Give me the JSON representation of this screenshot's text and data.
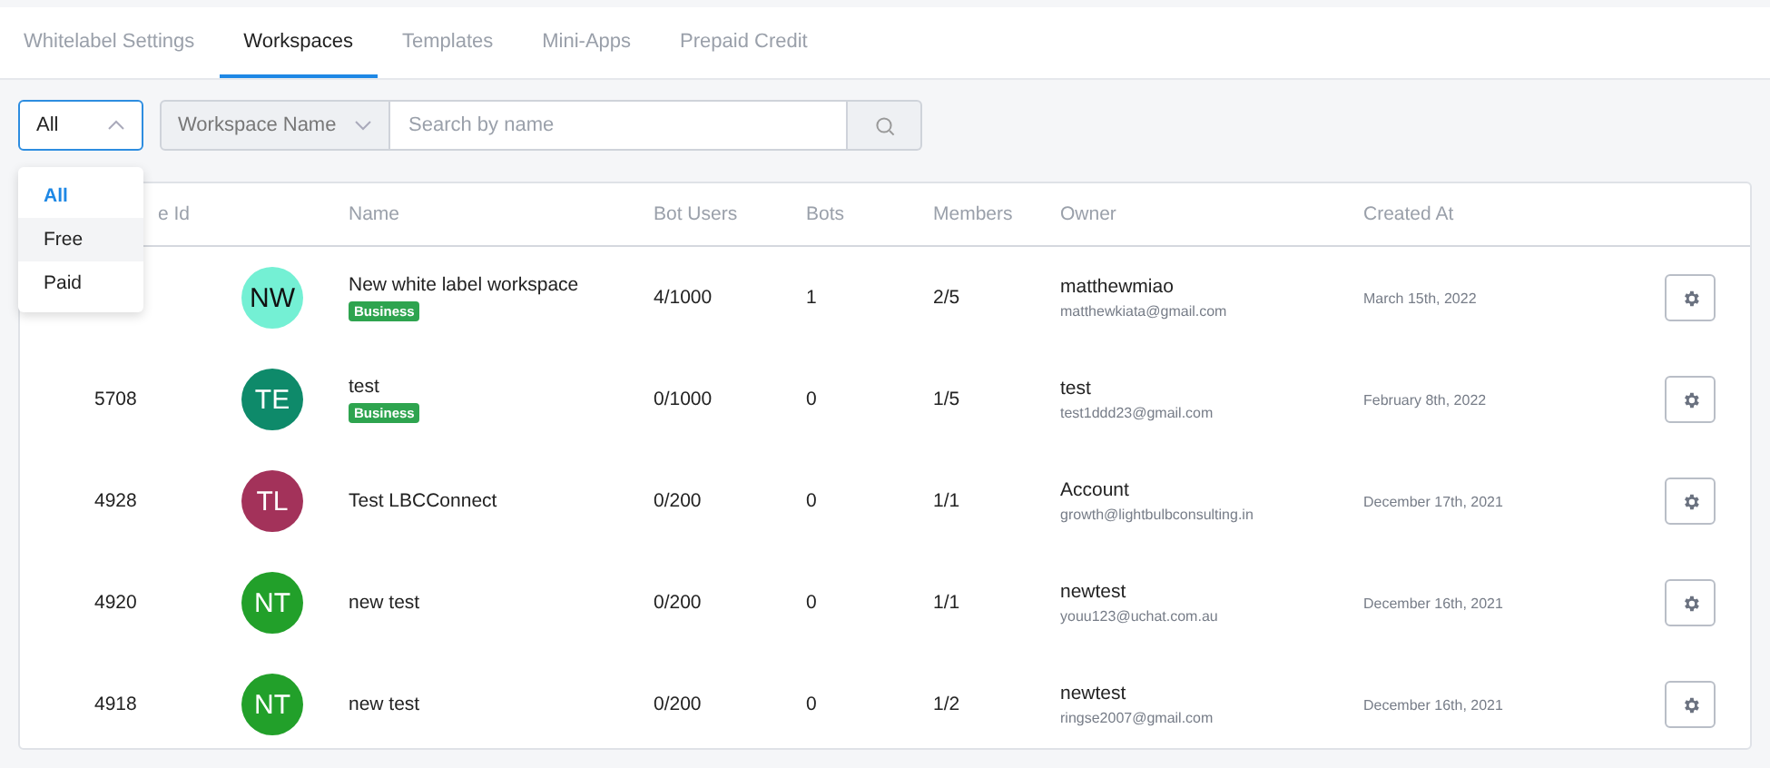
{
  "tabs": [
    {
      "label": "Whitelabel Settings",
      "selected": false
    },
    {
      "label": "Workspaces",
      "selected": true
    },
    {
      "label": "Templates",
      "selected": false
    },
    {
      "label": "Mini-Apps",
      "selected": false
    },
    {
      "label": "Prepaid Credit",
      "selected": false
    }
  ],
  "filters": {
    "plan_select": {
      "value": "All",
      "expanded": true
    },
    "field_select": {
      "value": "Workspace Name",
      "expanded": false
    },
    "search": {
      "placeholder": "Search by name"
    }
  },
  "plan_menu": [
    {
      "label": "All",
      "selected": true,
      "highlighted": false
    },
    {
      "label": "Free",
      "selected": false,
      "highlighted": true
    },
    {
      "label": "Paid",
      "selected": false,
      "highlighted": false
    }
  ],
  "table": {
    "columns": [
      "e Id",
      "Name",
      "Bot Users",
      "Bots",
      "Members",
      "Owner",
      "Created At"
    ],
    "rows": [
      {
        "initials": "NW",
        "color": "#74f0d4",
        "name": "New white label workspace",
        "badge": "Business",
        "bot_users": "4/1000",
        "bots": "1",
        "members": "2/5",
        "owner": "matthewmiao",
        "owner_email": "matthewkiata@gmail.com",
        "created_at": "March 15th, 2022"
      },
      {
        "id": "5708",
        "initials": "TE",
        "color": "#0e8a6a",
        "name": "test",
        "badge": "Business",
        "bot_users": "0/1000",
        "bots": "0",
        "members": "1/5",
        "owner": "test",
        "owner_email": "test1ddd23@gmail.com",
        "created_at": "February 8th, 2022"
      },
      {
        "id": "4928",
        "initials": "TL",
        "color": "#a3325a",
        "name": "Test LBCConnect",
        "bot_users": "0/200",
        "bots": "0",
        "members": "1/1",
        "owner": "Account",
        "owner_email": "growth@lightbulbconsulting.in",
        "created_at": "December 17th, 2021"
      },
      {
        "id": "4920",
        "initials": "NT",
        "color": "#22a02a",
        "name": "new test",
        "bot_users": "0/200",
        "bots": "0",
        "members": "1/1",
        "owner": "newtest",
        "owner_email": "youu123@uchat.com.au",
        "created_at": "December 16th, 2021"
      },
      {
        "id": "4918",
        "initials": "NT",
        "color": "#22a02a",
        "name": "new test",
        "bot_users": "0/200",
        "bots": "0",
        "members": "1/2",
        "owner": "newtest",
        "owner_email": "ringse2007@gmail.com",
        "created_at": "December 16th, 2021"
      }
    ]
  }
}
